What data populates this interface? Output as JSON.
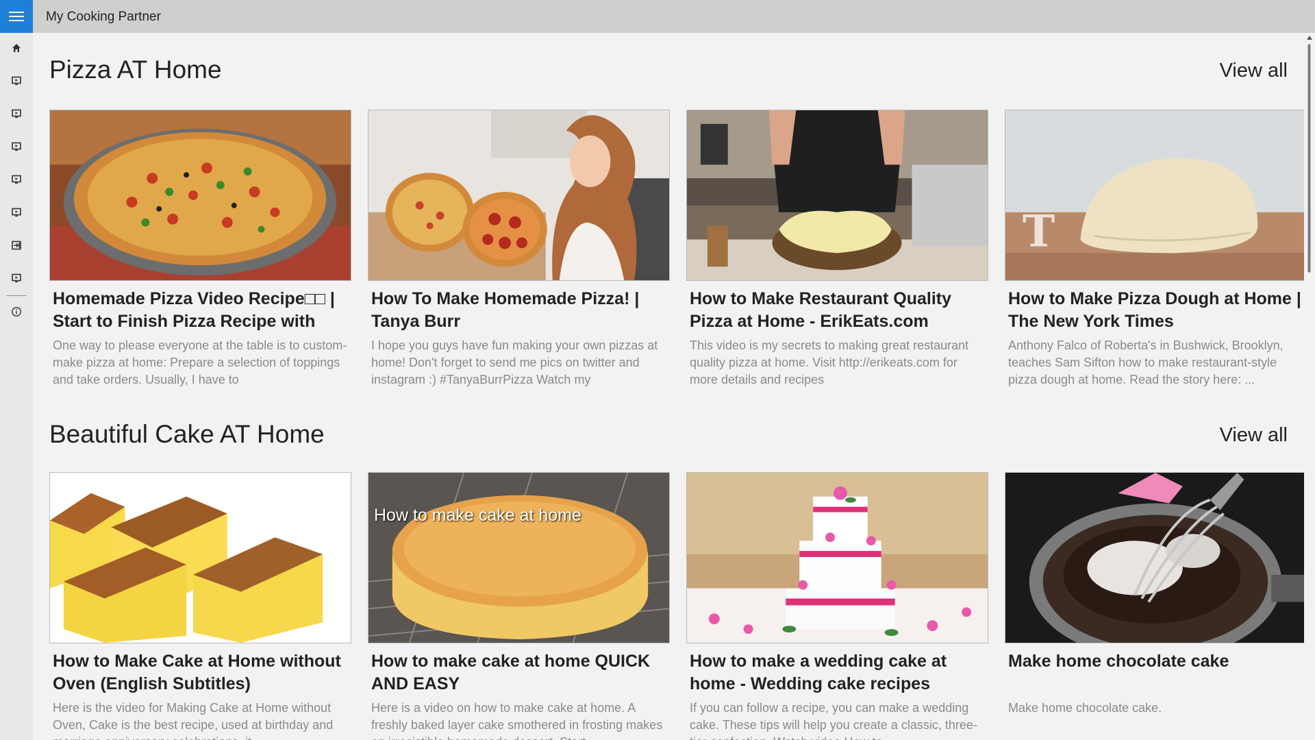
{
  "app": {
    "title": "My Cooking Partner"
  },
  "colors": {
    "accent": "#1e7fd8",
    "titlebar": "#cfcfcf",
    "sidebar": "#e8e8e8",
    "background": "#f2f2f2"
  },
  "sidebar": {
    "items": [
      {
        "icon": "home-icon"
      },
      {
        "icon": "screen-icon"
      },
      {
        "icon": "screen-icon"
      },
      {
        "icon": "screen-icon"
      },
      {
        "icon": "screen-icon"
      },
      {
        "icon": "screen-icon"
      },
      {
        "icon": "arrow-to-bar-icon"
      },
      {
        "icon": "screen-icon"
      },
      {
        "icon": "info-icon"
      }
    ]
  },
  "sections": [
    {
      "title": "Pizza AT Home",
      "view_all": "View all",
      "cards": [
        {
          "title": "Homemade Pizza Video Recipe□□ | Start to Finish Pizza Recipe with",
          "description": "One way to please everyone at the table is to custom-make pizza at home: Prepare a selection of toppings and take orders. Usually, I have to"
        },
        {
          "title": "How To Make Homemade Pizza! | Tanya Burr",
          "description": "I hope you guys have fun making your own pizzas at home! Don't forget to send me pics on twitter and instagram :) #TanyaBurrPizza Watch my"
        },
        {
          "title": "How to Make Restaurant Quality Pizza at Home - ErikEats.com",
          "description": "This video is my secrets to making great restaurant quality pizza at home. Visit http://erikeats.com for more details and recipes"
        },
        {
          "title": "How to Make Pizza Dough at Home | The New York Times",
          "description": "Anthony Falco of Roberta's in Bushwick, Brooklyn, teaches Sam Sifton how to make restaurant-style pizza dough at home. Read the story here: ..."
        }
      ]
    },
    {
      "title": "Beautiful Cake AT Home",
      "view_all": "View all",
      "cards": [
        {
          "title": "How to Make Cake at Home without Oven (English Subtitles)",
          "description": "Here is the video for Making Cake at Home without Oven, Cake is the best recipe, used at birthday and marriage anniversary celebrations, it"
        },
        {
          "title": "How to make cake at home QUICK AND EASY",
          "description": "Here is a video on how to make cake at home. A freshly baked layer cake smothered in frosting makes an irresistible homemade dessert. Start",
          "thumb_caption": "How to make cake at home"
        },
        {
          "title": "How to make a wedding cake at home - Wedding cake recipes",
          "description": "If you can follow a recipe, you can make a wedding cake. These tips will help you create a classic, three-tier confection. Watch video How to"
        },
        {
          "title": "Make home chocolate cake",
          "description": "Make home chocolate cake."
        }
      ]
    }
  ]
}
